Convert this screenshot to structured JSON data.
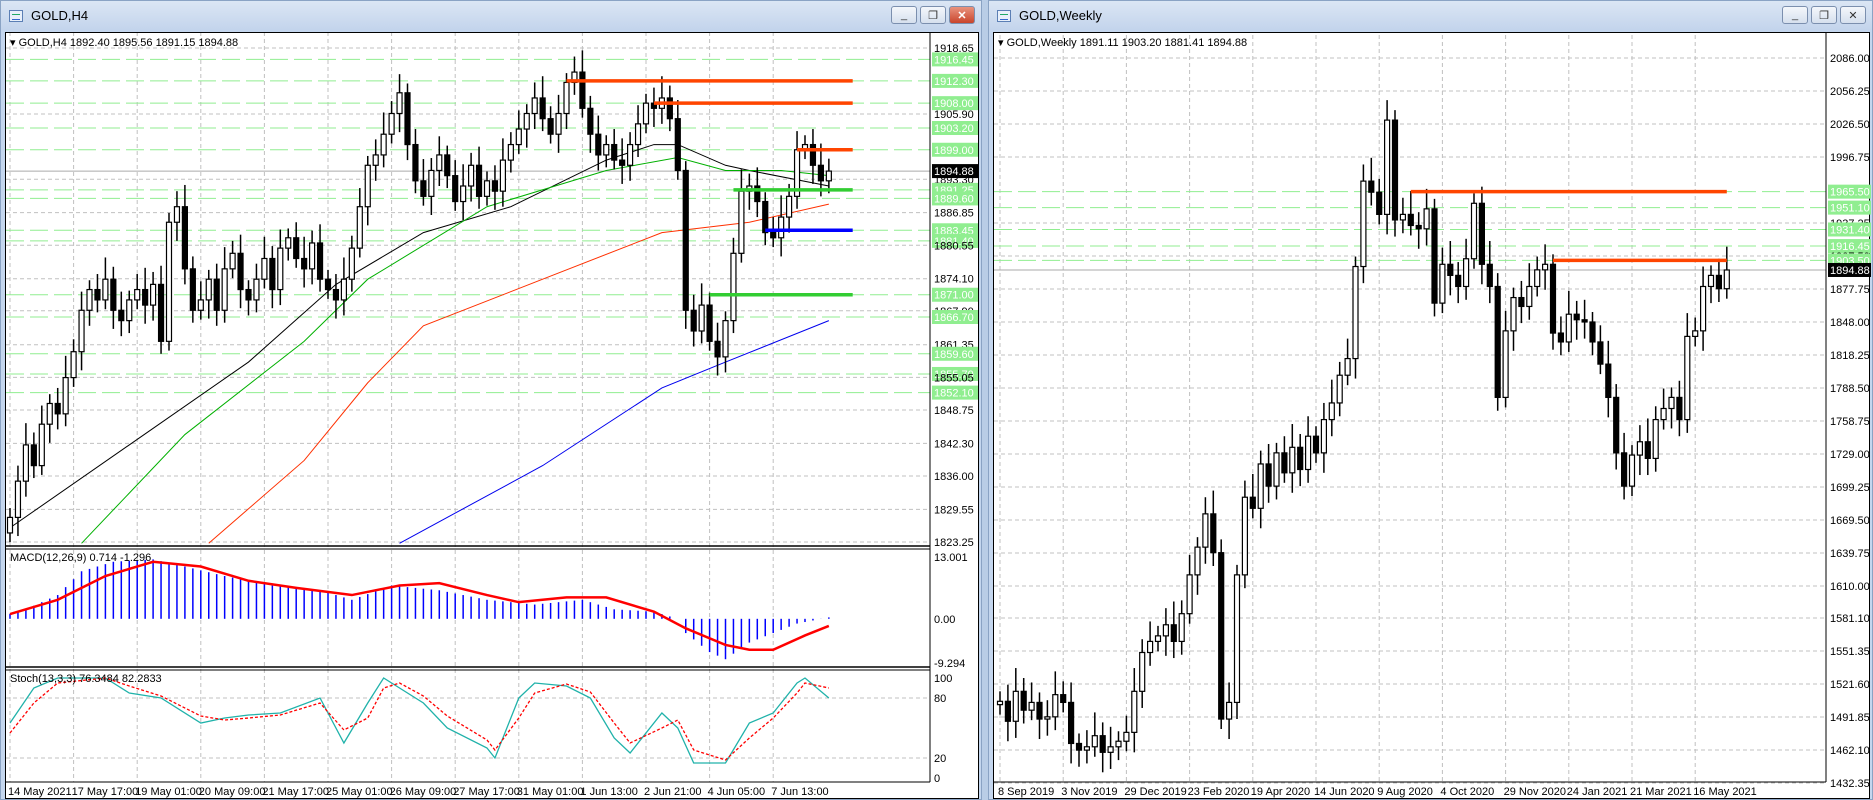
{
  "colors": {
    "bull": "#ffffff",
    "bear": "#000000",
    "level_orange": "#ff4500",
    "level_green": "#32cd32",
    "level_blue": "#0000ff",
    "grid": "#c0c0c0",
    "label_green_bg": "#90ee90",
    "ma_black": "#000000",
    "ma_green": "#00b000",
    "ma_red": "#ff3000",
    "ma_blue": "#0000ee",
    "macd_hist": "#0000ff",
    "macd_signal": "#ff0000",
    "stoch_main": "#20b2aa",
    "stoch_signal": "#ff0000"
  },
  "left": {
    "title": "GOLD,H4",
    "info": "GOLD,H4  1892.40 1895.56 1891.15 1894.88",
    "buttons": {
      "minimize": "_",
      "restore": "❐",
      "close": "✕"
    },
    "price_axis": [
      {
        "v": 1918.65
      },
      {
        "v": 1916.45,
        "hl": true
      },
      {
        "v": 1912.3,
        "hl": true
      },
      {
        "v": 1908.0,
        "hl": true
      },
      {
        "v": 1905.9
      },
      {
        "v": 1903.2,
        "hl": true
      },
      {
        "v": 1899.0,
        "hl": true
      },
      {
        "v": 1894.88,
        "current": true
      },
      {
        "v": 1893.3
      },
      {
        "v": 1891.25,
        "hl": true
      },
      {
        "v": 1889.6,
        "hl": true
      },
      {
        "v": 1886.85
      },
      {
        "v": 1883.45,
        "hl": true
      },
      {
        "v": 1881.4,
        "hl": true
      },
      {
        "v": 1880.55
      },
      {
        "v": 1874.1
      },
      {
        "v": 1871.0,
        "hl": true
      },
      {
        "v": 1867.9
      },
      {
        "v": 1866.7,
        "hl": true
      },
      {
        "v": 1861.35
      },
      {
        "v": 1859.6,
        "hl": true
      },
      {
        "v": 1855.7,
        "hl": true
      },
      {
        "v": 1855.05
      },
      {
        "v": 1852.1,
        "hl": true
      },
      {
        "v": 1848.75
      },
      {
        "v": 1842.3
      },
      {
        "v": 1836.0
      },
      {
        "v": 1829.55
      },
      {
        "v": 1823.25
      }
    ],
    "time_axis": [
      "14 May 2021",
      "17 May 17:00",
      "19 May 01:00",
      "20 May 09:00",
      "21 May 17:00",
      "25 May 01:00",
      "26 May 09:00",
      "27 May 17:00",
      "31 May 01:00",
      "1 Jun 13:00",
      "2 Jun 21:00",
      "4 Jun 05:00",
      "7 Jun 13:00"
    ],
    "closes": [
      1828,
      1835,
      1842,
      1838,
      1846,
      1850,
      1848,
      1855,
      1860,
      1868,
      1872,
      1870,
      1874,
      1868,
      1866,
      1870,
      1872,
      1869,
      1873,
      1862,
      1885,
      1888,
      1876,
      1868,
      1870,
      1874,
      1868,
      1876,
      1879,
      1872,
      1870,
      1874,
      1878,
      1872,
      1880,
      1882,
      1878,
      1876,
      1881,
      1874,
      1872,
      1870,
      1874,
      1880,
      1888,
      1896,
      1898,
      1902,
      1906,
      1910,
      1900,
      1893,
      1890,
      1895,
      1898,
      1894,
      1889,
      1892,
      1896,
      1890,
      1893,
      1891,
      1897,
      1900,
      1903,
      1906,
      1909,
      1905,
      1902,
      1906,
      1912,
      1914,
      1907,
      1902,
      1898,
      1900,
      1897,
      1896,
      1900,
      1904,
      1908,
      1907,
      1909,
      1905,
      1895,
      1868,
      1864,
      1869,
      1862,
      1859,
      1866,
      1879,
      1891,
      1892,
      1889,
      1883,
      1882,
      1886,
      1890,
      1899,
      1900,
      1896,
      1893,
      1894.88
    ],
    "moving_averages": [
      {
        "color": "#000000",
        "points": [
          [
            0,
            1826
          ],
          [
            15,
            1842
          ],
          [
            30,
            1858
          ],
          [
            41,
            1873
          ],
          [
            52,
            1883
          ],
          [
            63,
            1888
          ],
          [
            75,
            1897
          ],
          [
            81,
            1900
          ],
          [
            84,
            1900
          ],
          [
            90,
            1896
          ],
          [
            93,
            1895
          ],
          [
            103,
            1892
          ]
        ]
      },
      {
        "color": "#00b000",
        "points": [
          [
            9,
            1823
          ],
          [
            22,
            1844
          ],
          [
            37,
            1862
          ],
          [
            45,
            1874
          ],
          [
            60,
            1888
          ],
          [
            75,
            1895
          ],
          [
            84,
            1897.5
          ],
          [
            90,
            1895
          ],
          [
            97,
            1895
          ],
          [
            103,
            1894
          ]
        ]
      },
      {
        "color": "#ff3000",
        "points": [
          [
            25,
            1823
          ],
          [
            37,
            1839
          ],
          [
            45,
            1854
          ],
          [
            52,
            1865
          ],
          [
            67,
            1874
          ],
          [
            82,
            1883
          ],
          [
            93,
            1885
          ],
          [
            103,
            1888.5
          ]
        ]
      },
      {
        "color": "#0000ee",
        "points": [
          [
            49,
            1823
          ],
          [
            67,
            1838
          ],
          [
            82,
            1853
          ],
          [
            90,
            1858
          ],
          [
            103,
            1866
          ]
        ]
      }
    ],
    "levels": [
      {
        "price": 1912.3,
        "from": 70,
        "color": "#ff4500"
      },
      {
        "price": 1908.0,
        "from": 81,
        "color": "#ff4500"
      },
      {
        "price": 1899.0,
        "from": 99,
        "color": "#ff4500"
      },
      {
        "price": 1891.25,
        "from": 91,
        "color": "#32cd32"
      },
      {
        "price": 1883.45,
        "from": 95,
        "color": "#0000ff"
      },
      {
        "price": 1871.0,
        "from": 88,
        "color": "#32cd32"
      }
    ],
    "macd": {
      "label": "MACD(12,26,9) 0.714 -1.296",
      "axis": [
        "13.001",
        "0.00",
        "-9.294"
      ],
      "max": 13.001,
      "min": -9.294,
      "hist": [
        [
          0,
          1
        ],
        [
          2,
          2
        ],
        [
          6,
          5
        ],
        [
          9,
          10
        ],
        [
          13,
          12
        ],
        [
          18,
          12.5
        ],
        [
          22,
          11
        ],
        [
          27,
          9
        ],
        [
          33,
          7
        ],
        [
          39,
          6
        ],
        [
          43,
          4
        ],
        [
          48,
          7
        ],
        [
          54,
          6
        ],
        [
          60,
          4
        ],
        [
          66,
          3
        ],
        [
          72,
          4
        ],
        [
          76,
          2
        ],
        [
          81,
          1.5
        ],
        [
          84,
          0
        ],
        [
          85,
          -3
        ],
        [
          88,
          -7
        ],
        [
          90,
          -8.5
        ],
        [
          93,
          -5
        ],
        [
          96,
          -3
        ],
        [
          99,
          -1
        ],
        [
          103,
          0.3
        ]
      ],
      "signal": [
        [
          0,
          1
        ],
        [
          6,
          4
        ],
        [
          12,
          9
        ],
        [
          18,
          12
        ],
        [
          24,
          11
        ],
        [
          30,
          8
        ],
        [
          36,
          6.5
        ],
        [
          43,
          5
        ],
        [
          49,
          7
        ],
        [
          54,
          7.5
        ],
        [
          60,
          5
        ],
        [
          64,
          3.5
        ],
        [
          70,
          4.5
        ],
        [
          75,
          4.5
        ],
        [
          81,
          1.5
        ],
        [
          85,
          -2
        ],
        [
          90,
          -5.5
        ],
        [
          93,
          -6.5
        ],
        [
          96,
          -6.5
        ],
        [
          100,
          -3.5
        ],
        [
          103,
          -1.5
        ]
      ]
    },
    "stoch": {
      "label": "Stoch(13,3,3) 76.3484 82.2833",
      "axis": [
        "100",
        "80",
        "20",
        "0"
      ],
      "main": [
        [
          0,
          55
        ],
        [
          3,
          90
        ],
        [
          6,
          100
        ],
        [
          12,
          100
        ],
        [
          15,
          85
        ],
        [
          19,
          80
        ],
        [
          24,
          55
        ],
        [
          27,
          60
        ],
        [
          30,
          63
        ],
        [
          34,
          65
        ],
        [
          39,
          80
        ],
        [
          42,
          35
        ],
        [
          45,
          75
        ],
        [
          47,
          100
        ],
        [
          49,
          90
        ],
        [
          52,
          75
        ],
        [
          55,
          50
        ],
        [
          60,
          30
        ],
        [
          61,
          20
        ],
        [
          64,
          80
        ],
        [
          66,
          95
        ],
        [
          70,
          92
        ],
        [
          73,
          80
        ],
        [
          76,
          40
        ],
        [
          78,
          25
        ],
        [
          82,
          65
        ],
        [
          84,
          50
        ],
        [
          86,
          15
        ],
        [
          90,
          15
        ],
        [
          93,
          55
        ],
        [
          96,
          65
        ],
        [
          99,
          95
        ],
        [
          100,
          100
        ],
        [
          103,
          80
        ]
      ],
      "signal": [
        [
          0,
          45
        ],
        [
          3,
          75
        ],
        [
          6,
          95
        ],
        [
          12,
          100
        ],
        [
          15,
          92
        ],
        [
          19,
          82
        ],
        [
          24,
          62
        ],
        [
          27,
          58
        ],
        [
          30,
          60
        ],
        [
          34,
          63
        ],
        [
          39,
          75
        ],
        [
          42,
          48
        ],
        [
          45,
          60
        ],
        [
          47,
          90
        ],
        [
          49,
          95
        ],
        [
          52,
          82
        ],
        [
          55,
          62
        ],
        [
          60,
          38
        ],
        [
          61,
          28
        ],
        [
          64,
          60
        ],
        [
          66,
          85
        ],
        [
          70,
          94
        ],
        [
          73,
          86
        ],
        [
          76,
          55
        ],
        [
          78,
          35
        ],
        [
          82,
          50
        ],
        [
          84,
          58
        ],
        [
          86,
          28
        ],
        [
          90,
          18
        ],
        [
          93,
          40
        ],
        [
          96,
          60
        ],
        [
          99,
          85
        ],
        [
          100,
          95
        ],
        [
          103,
          90
        ]
      ]
    }
  },
  "right": {
    "title": "GOLD,Weekly",
    "info": "GOLD,Weekly  1891.11 1903.20 1881.41 1894.88",
    "buttons": {
      "minimize": "_",
      "restore": "❐",
      "close": "✕"
    },
    "price_axis": [
      {
        "v": 2086.0
      },
      {
        "v": 2056.25
      },
      {
        "v": 2026.5
      },
      {
        "v": 1996.75
      },
      {
        "v": 1965.5,
        "hl": true
      },
      {
        "v": 1951.1,
        "hl": true
      },
      {
        "v": 1937.25
      },
      {
        "v": 1931.4,
        "hl": true
      },
      {
        "v": 1916.45,
        "hl": true
      },
      {
        "v": 1907.5
      },
      {
        "v": 1903.5,
        "hl": true
      },
      {
        "v": 1894.88,
        "current": true
      },
      {
        "v": 1877.75
      },
      {
        "v": 1848.0
      },
      {
        "v": 1818.25
      },
      {
        "v": 1788.5
      },
      {
        "v": 1758.75
      },
      {
        "v": 1729.0
      },
      {
        "v": 1699.25
      },
      {
        "v": 1669.5
      },
      {
        "v": 1639.75
      },
      {
        "v": 1610.0
      },
      {
        "v": 1581.1
      },
      {
        "v": 1551.35
      },
      {
        "v": 1521.6
      },
      {
        "v": 1491.85
      },
      {
        "v": 1462.1
      },
      {
        "v": 1432.35
      }
    ],
    "time_axis": [
      "8 Sep 2019",
      "3 Nov 2019",
      "29 Dec 2019",
      "23 Feb 2020",
      "19 Apr 2020",
      "14 Jun 2020",
      "9 Aug 2020",
      "4 Oct 2020",
      "29 Nov 2020",
      "24 Jan 2021",
      "21 Mar 2021",
      "16 May 2021"
    ],
    "closes": [
      1506,
      1488,
      1515,
      1498,
      1505,
      1490,
      1492,
      1512,
      1505,
      1468,
      1462,
      1465,
      1475,
      1460,
      1465,
      1470,
      1478,
      1515,
      1550,
      1560,
      1565,
      1575,
      1560,
      1585,
      1620,
      1645,
      1675,
      1640,
      1490,
      1505,
      1620,
      1690,
      1680,
      1720,
      1700,
      1730,
      1712,
      1735,
      1715,
      1745,
      1730,
      1760,
      1775,
      1800,
      1815,
      1898,
      1975,
      1965,
      1945,
      2030,
      1940,
      1945,
      1935,
      1932,
      1950,
      1865,
      1900,
      1890,
      1880,
      1905,
      1955,
      1900,
      1880,
      1780,
      1840,
      1870,
      1862,
      1880,
      1895,
      1900,
      1838,
      1830,
      1855,
      1850,
      1848,
      1830,
      1810,
      1780,
      1730,
      1700,
      1728,
      1740,
      1725,
      1760,
      1770,
      1780,
      1760,
      1835,
      1840,
      1880,
      1890,
      1878,
      1894.88
    ],
    "levels": [
      {
        "price": 1965.5,
        "from": 52,
        "color": "#ff4500"
      },
      {
        "price": 1903.5,
        "from": 70,
        "color": "#ff4500"
      }
    ]
  }
}
